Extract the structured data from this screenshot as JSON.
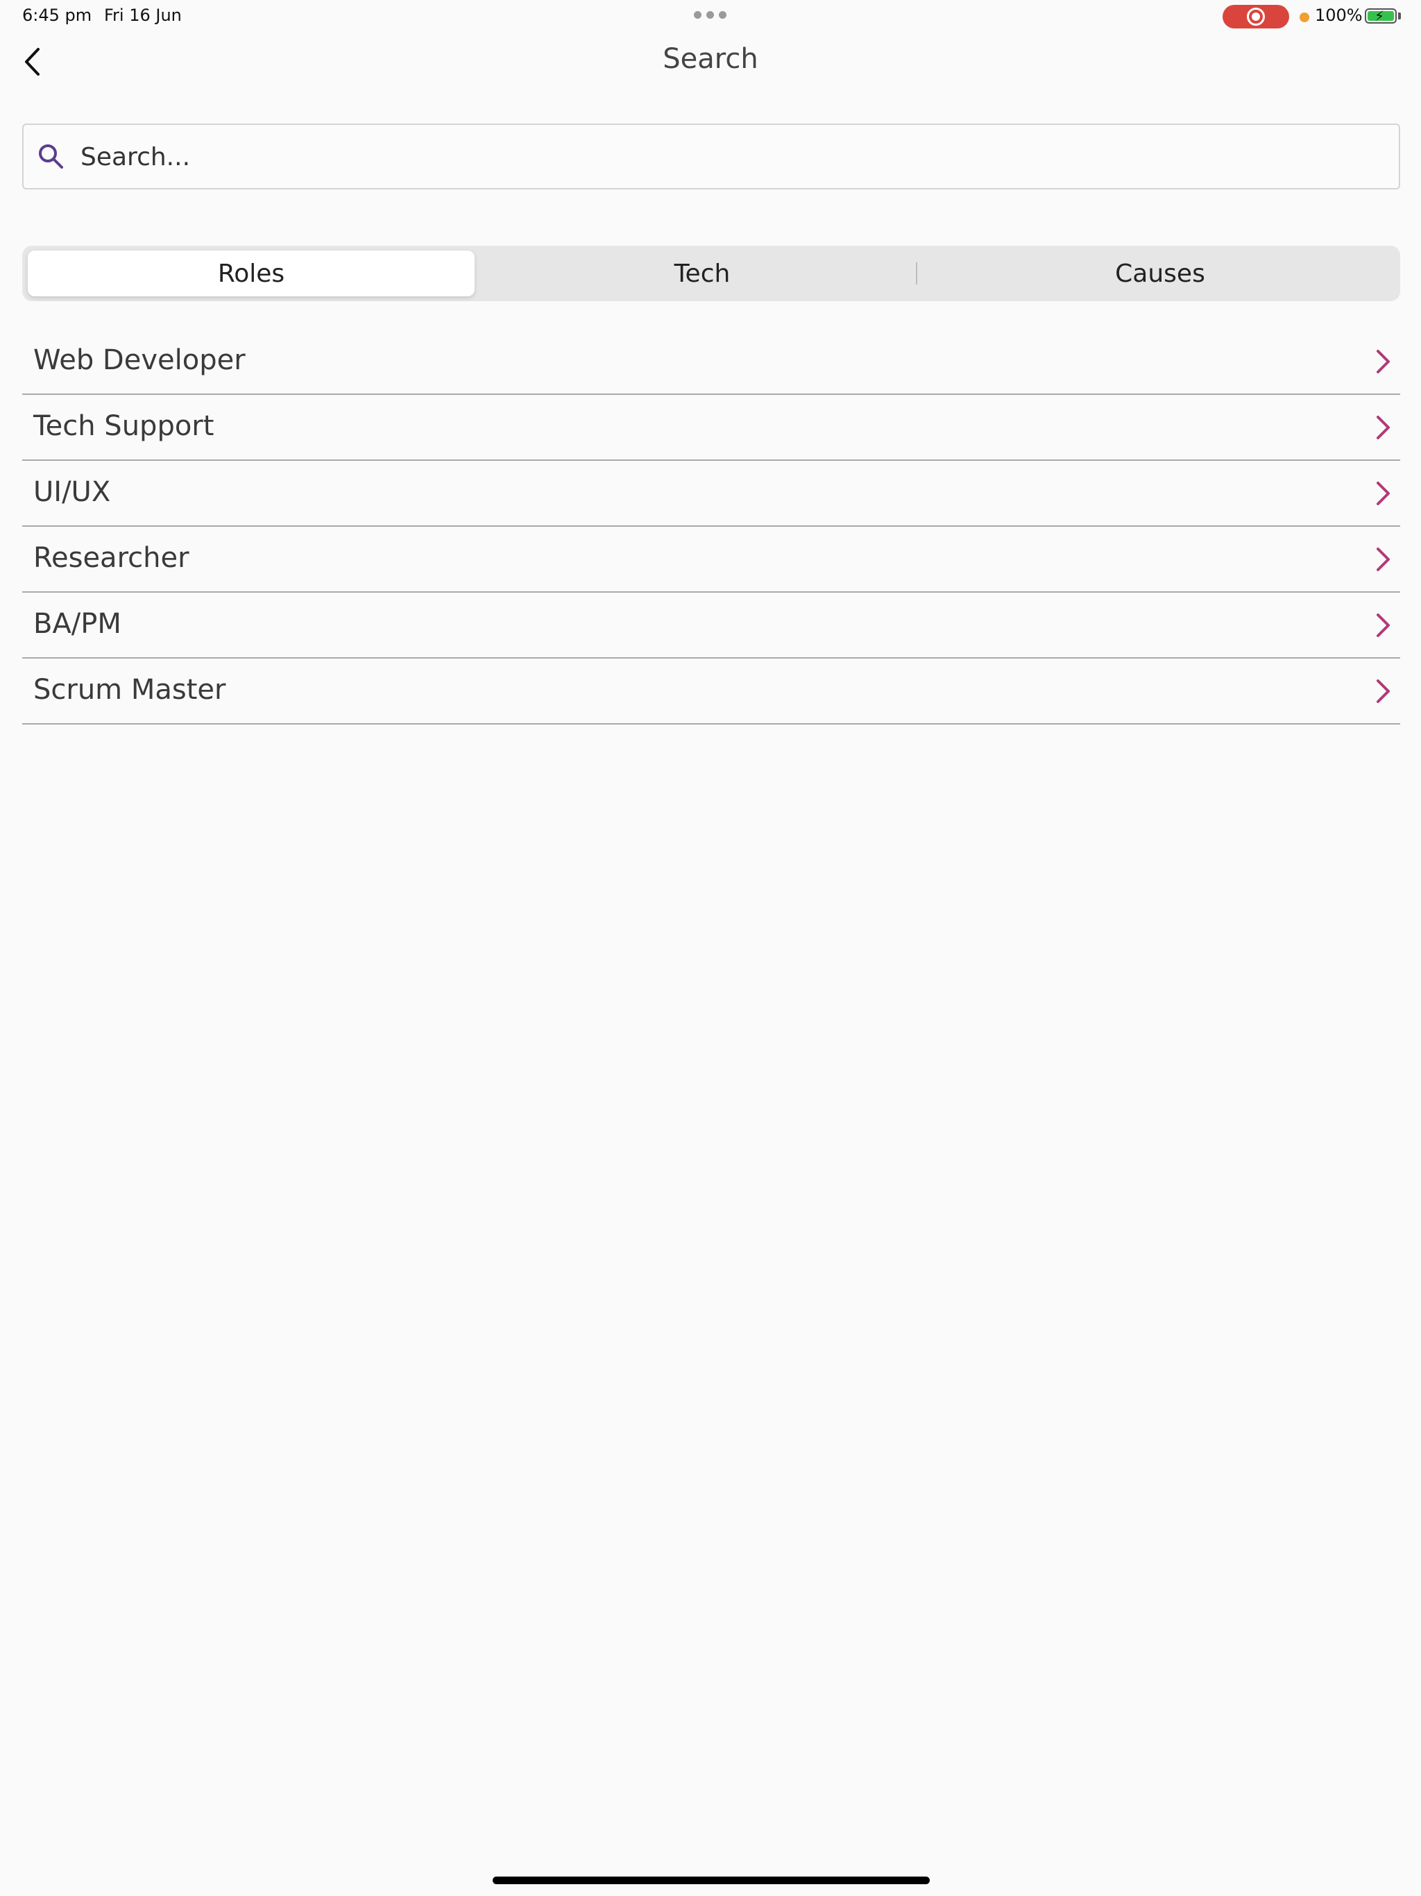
{
  "status_bar": {
    "time": "6:45 pm",
    "date": "Fri 16 Jun",
    "battery": "100%"
  },
  "nav": {
    "title": "Search",
    "back_icon": "chevron-left-icon"
  },
  "search": {
    "placeholder": "Search...",
    "value": "",
    "icon": "search-icon"
  },
  "tabs": [
    {
      "label": "Roles",
      "active": true
    },
    {
      "label": "Tech",
      "active": false
    },
    {
      "label": "Causes",
      "active": false
    }
  ],
  "list": {
    "items": [
      {
        "label": "Web Developer"
      },
      {
        "label": "Tech Support"
      },
      {
        "label": "UI/UX"
      },
      {
        "label": "Researcher"
      },
      {
        "label": "BA/PM"
      },
      {
        "label": "Scrum Master"
      }
    ],
    "chevron_icon": "chevron-right-icon"
  },
  "colors": {
    "accent_chevron": "#b03a78",
    "search_icon": "#5b3d8f",
    "record_red": "#d9453c",
    "battery_green": "#35c24c"
  }
}
